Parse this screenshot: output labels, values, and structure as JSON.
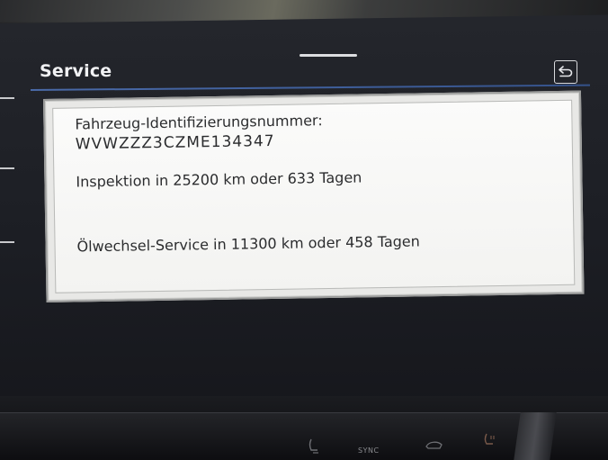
{
  "header": {
    "title": "Service",
    "back_icon": "back-arrow-icon"
  },
  "dialog": {
    "vin_label": "Fahrzeug-Identifizierungsnummer:",
    "vin_value": "WVWZZZ3CZME134347",
    "inspection": "Inspektion in 25200 km oder 633 Tagen",
    "oil_service": "Ölwechsel-Service in 11300 km oder 458 Tagen"
  },
  "bottom_controls": {
    "sync_label": "SYNC",
    "icons": [
      "seat-heating-icon",
      "air-recirculation-icon",
      "heated-steering-icon"
    ]
  },
  "colors": {
    "accent_line": "#4a6aa8",
    "screen_bg": "#1e2026",
    "dialog_bg": "#f7f7f5"
  }
}
